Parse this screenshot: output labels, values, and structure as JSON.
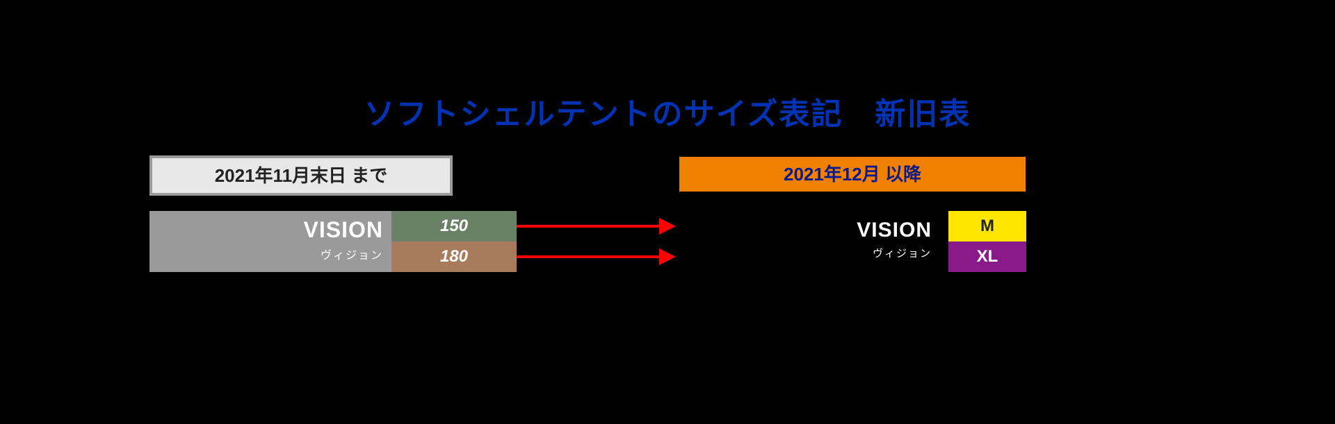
{
  "title": "ソフトシェルテントのサイズ表記　新旧表",
  "old": {
    "header": "2021年11月末日 まで",
    "label_en": "VISION",
    "label_jp": "ヴィジョン",
    "sizes": [
      "150",
      "180"
    ]
  },
  "new": {
    "header": "2021年12月 以降",
    "label_en": "VISION",
    "label_jp": "ヴィジョン",
    "sizes": [
      "M",
      "XL"
    ]
  },
  "chart_data": {
    "type": "table",
    "title": "ソフトシェルテントのサイズ表記　新旧表",
    "mapping": [
      {
        "product": "VISION",
        "old_size": "150",
        "new_size": "M"
      },
      {
        "product": "VISION",
        "old_size": "180",
        "new_size": "XL"
      }
    ],
    "columns": [
      "2021年11月末日 まで",
      "2021年12月 以降"
    ]
  }
}
